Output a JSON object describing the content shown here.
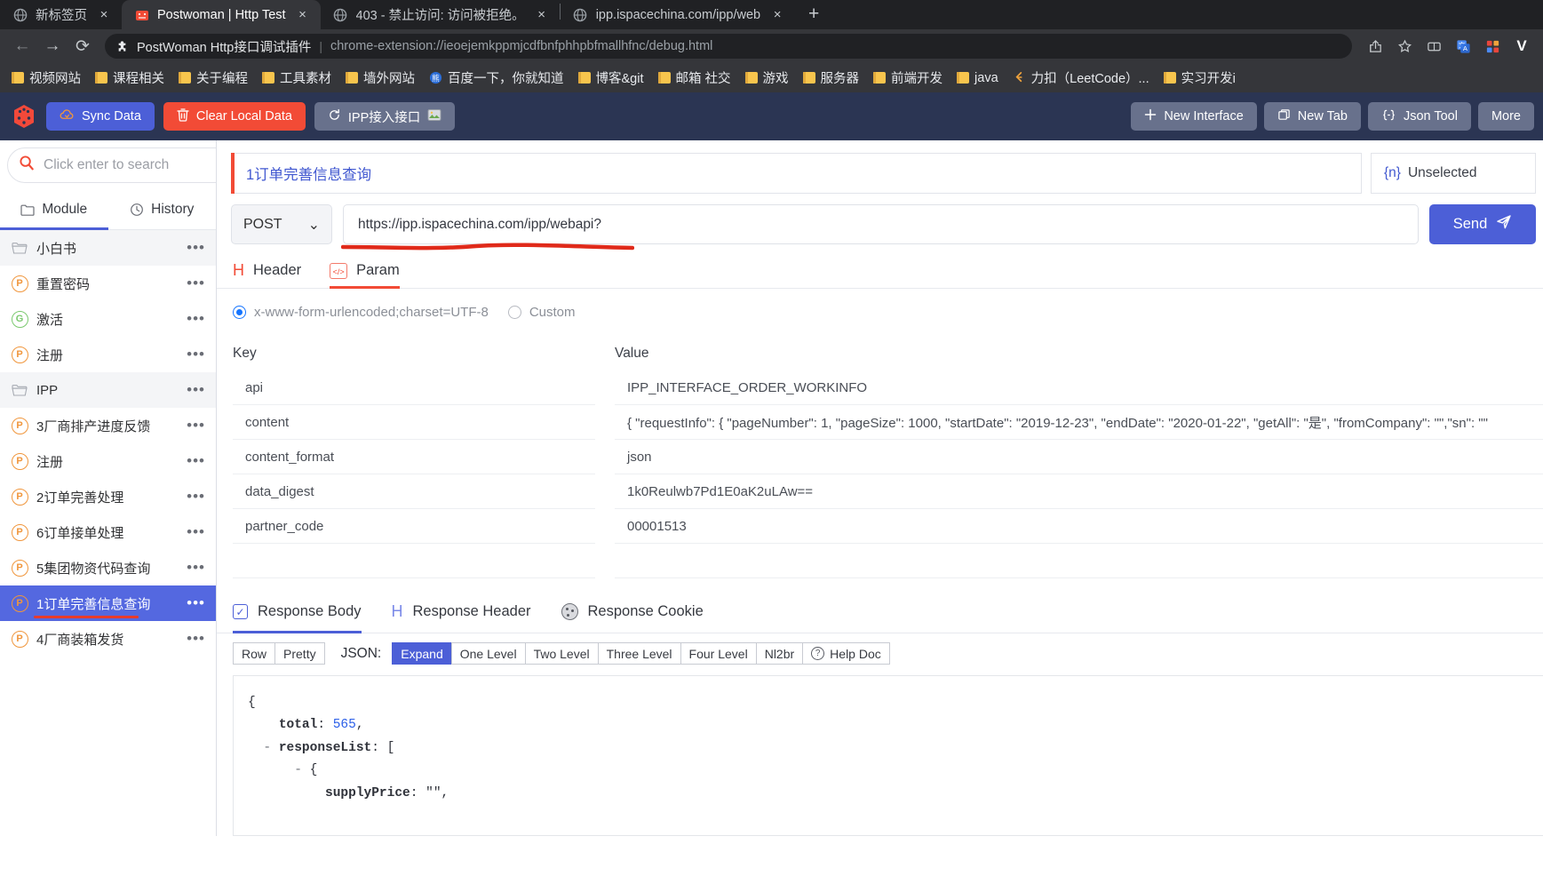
{
  "browser": {
    "tabs": [
      {
        "title": "新标签页",
        "favicon": "globe-icon",
        "active": false
      },
      {
        "title": "Postwoman | Http Test",
        "favicon": "postwoman-icon",
        "active": true
      },
      {
        "title": "403 - 禁止访问: 访问被拒绝。",
        "favicon": "globe-icon",
        "active": false
      },
      {
        "title": "ipp.ispacechina.com/ipp/web",
        "favicon": "globe-icon",
        "active": false
      }
    ],
    "tab_close_label": "×",
    "new_tab_label": "+",
    "nav": {
      "back": "←",
      "forward": "→",
      "reload": "⟳"
    },
    "omnibox": {
      "extension_name": "PostWoman Http接口调试插件",
      "divider": "|",
      "url": "chrome-extension://ieoejemkppmjcdfbnfphhpbfmallhfnc/debug.html"
    },
    "toolbar_icons": [
      "share-icon",
      "star-icon",
      "reading-list-icon",
      "translate-icon",
      "extensions-icon"
    ],
    "profile_initial": "V",
    "bookmarks": [
      {
        "label": "视频网站",
        "icon": "folder-icon"
      },
      {
        "label": "课程相关",
        "icon": "folder-icon"
      },
      {
        "label": "关于编程",
        "icon": "folder-icon"
      },
      {
        "label": "工具素材",
        "icon": "folder-icon"
      },
      {
        "label": "墙外网站",
        "icon": "folder-icon"
      },
      {
        "label": "百度一下，你就知道",
        "icon": "baidu-icon"
      },
      {
        "label": "博客&git",
        "icon": "folder-icon"
      },
      {
        "label": "邮箱 社交",
        "icon": "folder-icon"
      },
      {
        "label": "游戏",
        "icon": "folder-icon"
      },
      {
        "label": "服务器",
        "icon": "folder-icon"
      },
      {
        "label": "前端开发",
        "icon": "folder-icon"
      },
      {
        "label": "java",
        "icon": "folder-icon"
      },
      {
        "label": "力扣（LeetCode）...",
        "icon": "leetcode-icon"
      },
      {
        "label": "实习开发i",
        "icon": "folder-icon"
      }
    ]
  },
  "app_header": {
    "logo": "dice-logo-icon",
    "sync_label": "Sync Data",
    "sync_icon": "cloud-sync-icon",
    "clear_label": "Clear Local Data",
    "clear_icon": "trash-icon",
    "ipp_label": "IPP接入接口",
    "ipp_icon": "refresh-icon",
    "ipp_trailing_icon": "image-icon",
    "new_interface_label": "New Interface",
    "new_interface_icon": "plus-icon",
    "new_tab_label": "New Tab",
    "new_tab_icon": "copy-icon",
    "json_tool_label": "Json Tool",
    "json_tool_icon": "braces-icon",
    "more_label": "More"
  },
  "sidebar": {
    "search_placeholder": "Click enter to search",
    "search_value": "",
    "search_icon": "search-icon",
    "clear_icon": "close-icon",
    "tabs": [
      {
        "label": "Module",
        "icon": "folder-icon",
        "active": true
      },
      {
        "label": "History",
        "icon": "clock-icon",
        "active": false
      }
    ],
    "dots": "•••",
    "items": [
      {
        "label": "小白书",
        "type": "folder",
        "badge": "",
        "selected": false
      },
      {
        "label": "重置密码",
        "type": "item",
        "badge": "P",
        "selected": false
      },
      {
        "label": "激活",
        "type": "item",
        "badge": "G",
        "selected": false
      },
      {
        "label": "注册",
        "type": "item",
        "badge": "P",
        "selected": false
      },
      {
        "label": "IPP",
        "type": "folder",
        "badge": "",
        "selected": false
      },
      {
        "label": "3厂商排产进度反馈",
        "type": "item",
        "badge": "P",
        "selected": false
      },
      {
        "label": "注册",
        "type": "item",
        "badge": "P",
        "selected": false
      },
      {
        "label": "2订单完善处理",
        "type": "item",
        "badge": "P",
        "selected": false
      },
      {
        "label": "6订单接单处理",
        "type": "item",
        "badge": "P",
        "selected": false
      },
      {
        "label": "5集团物资代码查询",
        "type": "item",
        "badge": "P",
        "selected": false
      },
      {
        "label": "1订单完善信息查询",
        "type": "item",
        "badge": "P",
        "selected": true
      },
      {
        "label": "4厂商装箱发货",
        "type": "item",
        "badge": "P",
        "selected": false
      }
    ]
  },
  "main": {
    "interface_name": "1订单完善信息查询",
    "environment": "Unselected",
    "environment_brace": "{n}",
    "method": "POST",
    "method_caret": "⌄",
    "url": "https://ipp.ispacechina.com/ipp/webapi?",
    "send_label": "Send",
    "send_icon": "paper-plane-icon",
    "request_tabs": [
      {
        "label": "Header",
        "icon": "header-h-icon",
        "active": false
      },
      {
        "label": "Param",
        "icon": "code-brackets-icon",
        "active": true
      }
    ],
    "encoding_options": [
      {
        "label": "x-www-form-urlencoded;charset=UTF-8",
        "selected": true
      },
      {
        "label": "Custom",
        "selected": false
      }
    ],
    "param_headers": {
      "key": "Key",
      "value": "Value"
    },
    "params": [
      {
        "key": "api",
        "value": "IPP_INTERFACE_ORDER_WORKINFO"
      },
      {
        "key": "content",
        "value": "{ \"requestInfo\": { \"pageNumber\": 1, \"pageSize\": 1000, \"startDate\": \"2019-12-23\", \"endDate\": \"2020-01-22\", \"getAll\": \"是\", \"fromCompany\": \"\",\"sn\": \"\""
      },
      {
        "key": "content_format",
        "value": "json"
      },
      {
        "key": "data_digest",
        "value": "1k0Reulwb7Pd1E0aK2uLAw=="
      },
      {
        "key": "partner_code",
        "value": "00001513"
      },
      {
        "key": "",
        "value": ""
      }
    ],
    "response_tabs": [
      {
        "label": "Response Body",
        "icon": "checkbox-icon",
        "active": true
      },
      {
        "label": "Response Header",
        "icon": "header-h-icon",
        "active": false
      },
      {
        "label": "Response Cookie",
        "icon": "cookie-icon",
        "active": false
      }
    ],
    "view_modes": [
      {
        "label": "Row",
        "on": false
      },
      {
        "label": "Pretty",
        "on": false
      }
    ],
    "json_label": "JSON:",
    "json_levels": [
      {
        "label": "Expand",
        "on": true
      },
      {
        "label": "One Level",
        "on": false
      },
      {
        "label": "Two Level",
        "on": false
      },
      {
        "label": "Three Level",
        "on": false
      },
      {
        "label": "Four Level",
        "on": false
      },
      {
        "label": "Nl2br",
        "on": false
      }
    ],
    "help_doc_label": "Help Doc",
    "help_doc_icon": "question-circle-icon",
    "response_body_lines": [
      {
        "indent": 0,
        "dash": "",
        "key": "",
        "sep": "",
        "value": "{",
        "type": "brace"
      },
      {
        "indent": 1,
        "dash": "",
        "key": "total",
        "sep": ": ",
        "value": "565",
        "type": "num",
        "trail": ","
      },
      {
        "indent": 1,
        "dash": "-",
        "key": "responseList",
        "sep": ": ",
        "value": "[",
        "type": "brace"
      },
      {
        "indent": 2,
        "dash": "-",
        "key": "",
        "sep": "",
        "value": "{",
        "type": "brace"
      },
      {
        "indent": 3,
        "dash": "",
        "key": "supplyPrice",
        "sep": ": ",
        "value": "\"\"",
        "type": "str",
        "trail": ","
      }
    ]
  }
}
